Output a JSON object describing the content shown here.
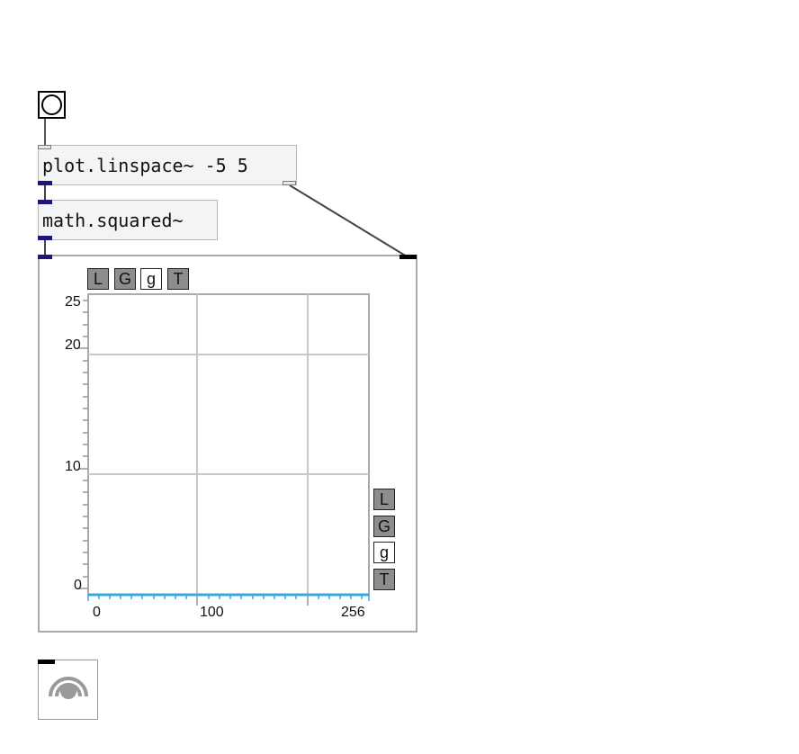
{
  "objects": {
    "linspace": "plot.linspace~ -5 5",
    "squared": "math.squared~"
  },
  "plot": {
    "top_toolbar": [
      "L",
      "G",
      "g",
      "T"
    ],
    "side_toolbar": [
      "L",
      "G",
      "g",
      "T"
    ],
    "y_ticks": [
      "25",
      "20",
      "10",
      "0"
    ],
    "x_ticks": [
      "0",
      "100",
      "256"
    ],
    "axis_color": "#36a9e1",
    "grid_color": "#c8c8c8"
  },
  "icons": {
    "bang": "bang-circle-icon",
    "dac": "speaker-waves-icon"
  },
  "colors": {
    "signal_outlet": "#1d157e",
    "object_bg": "#f3f4f5"
  }
}
